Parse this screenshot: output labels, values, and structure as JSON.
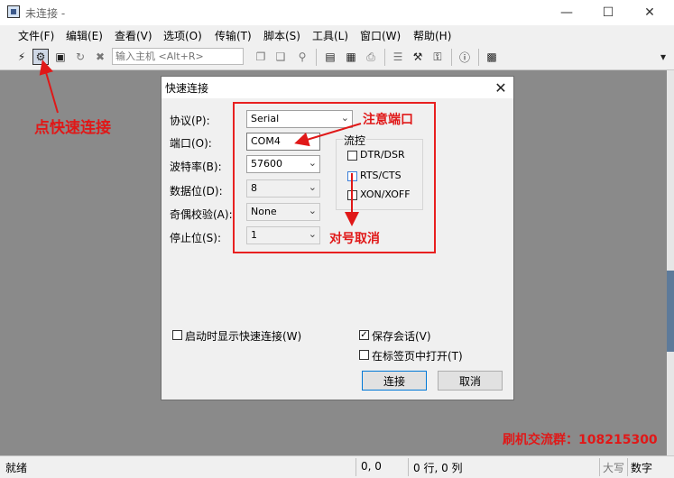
{
  "window": {
    "title": "未连接 -"
  },
  "menu": [
    "文件(F)",
    "编辑(E)",
    "查看(V)",
    "选项(O)",
    "传输(T)",
    "脚本(S)",
    "工具(L)",
    "窗口(W)",
    "帮助(H)"
  ],
  "toolbar": {
    "host_placeholder": "输入主机 <Alt+R>"
  },
  "annotations": {
    "click_quick_connect": "点快速连接",
    "note_port": "注意端口",
    "uncheck": "对号取消",
    "group": "刷机交流群：108215300"
  },
  "dialog": {
    "title": "快速连接",
    "protocol_label": "协议(P):",
    "protocol_value": "Serial",
    "port_label": "端口(O):",
    "port_value": "COM4",
    "baud_label": "波特率(B):",
    "baud_value": "57600",
    "databits_label": "数据位(D):",
    "databits_value": "8",
    "parity_label": "奇偶校验(A):",
    "parity_value": "None",
    "stopbits_label": "停止位(S):",
    "stopbits_value": "1",
    "flow_title": "流控",
    "flow_dtr": "DTR/DSR",
    "flow_rts": "RTS/CTS",
    "flow_xon": "XON/XOFF",
    "show_on_startup": "启动时显示快速连接(W)",
    "save_session": "保存会话(V)",
    "open_in_tab": "在标签页中打开(T)",
    "connect": "连接",
    "cancel": "取消"
  },
  "status": {
    "ready": "就绪",
    "coords": "0, 0",
    "rowcol": "0 行, 0 列",
    "caps": "大写",
    "num": "数字"
  }
}
